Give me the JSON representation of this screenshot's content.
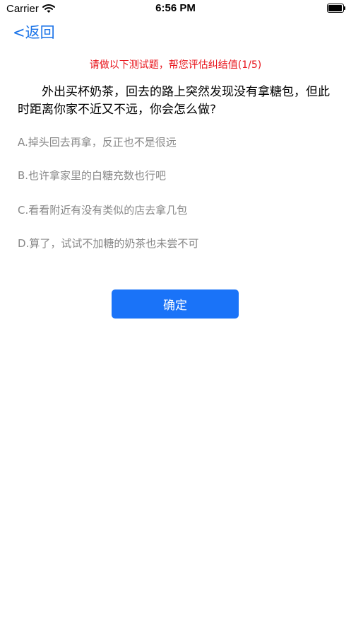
{
  "status_bar": {
    "carrier": "Carrier",
    "time": "6:56 PM"
  },
  "nav": {
    "back_label": "<返回"
  },
  "notice": "请做以下测试题，帮您评估纠结值(1/5)",
  "question": "外出买杯奶茶，回去的路上突然发现没有拿糖包，但此时距离你家不近又不远，你会怎么做?",
  "options": [
    "A.掉头回去再拿，反正也不是很远",
    "B.也许拿家里的白糖充数也行吧",
    "C.看看附近有没有类似的店去拿几包",
    "D.算了，试试不加糖的奶茶也未尝不可"
  ],
  "confirm_label": "确定",
  "colors": {
    "accent": "#1a73f8",
    "notice": "#e8141b",
    "option_text": "#888888"
  }
}
